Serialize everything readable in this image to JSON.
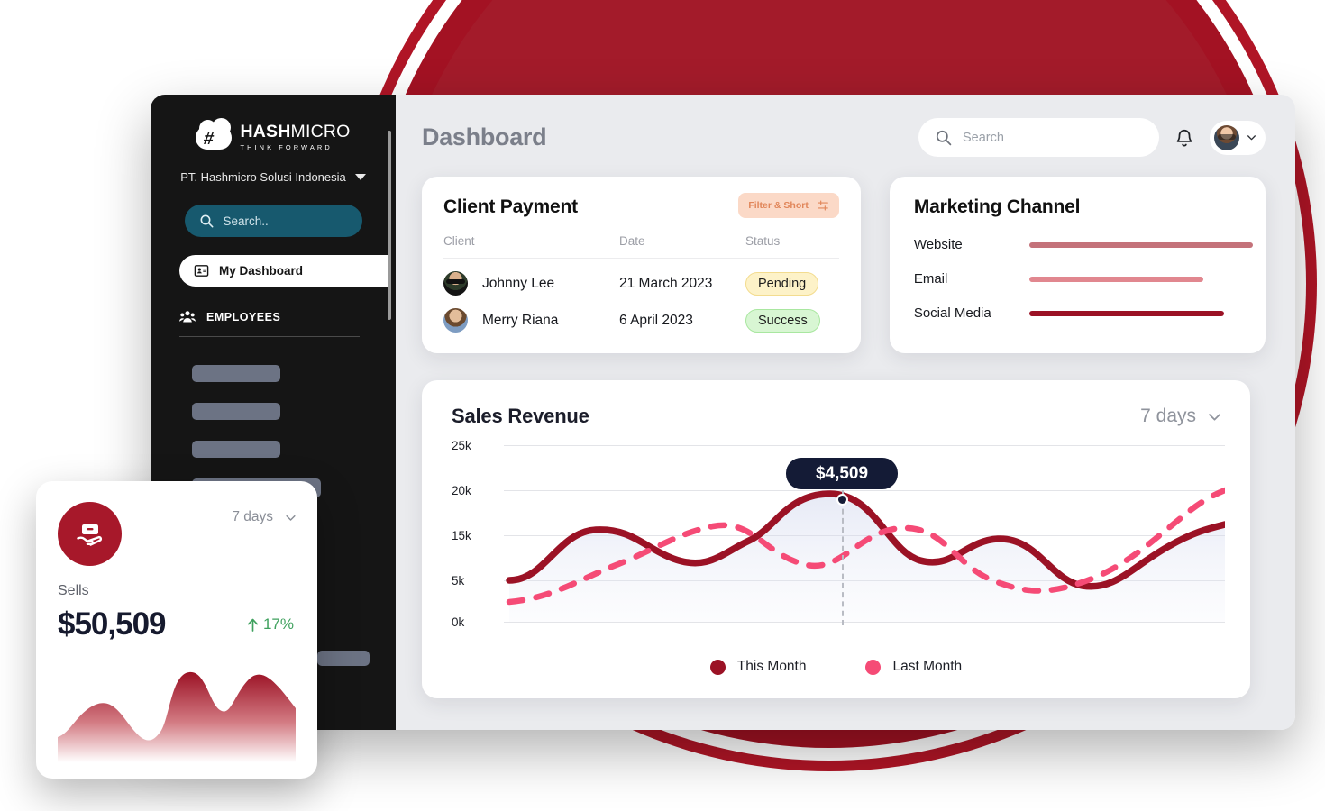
{
  "brand": {
    "logo_name_bold": "HASH",
    "logo_name_light": "MICRO",
    "logo_tagline": "THINK FORWARD",
    "logo_glyph": "#",
    "accent_red": "#a7182a",
    "accent_pink": "#f54b76",
    "sidebar_bg": "#151515",
    "search_bg": "#17596e"
  },
  "sidebar": {
    "company": "PT. Hashmicro Solusi Indonesia",
    "company_caret_icon": "chevron-down-icon",
    "search": {
      "placeholder": "Search..",
      "icon": "search-icon"
    },
    "nav_active": {
      "label": "My Dashboard",
      "icon": "dashboard-icon"
    },
    "section": {
      "label": "EMPLOYEES",
      "icon": "people-icon"
    },
    "placeholder_items": 5
  },
  "header": {
    "title": "Dashboard",
    "search": {
      "placeholder": "Search",
      "value": "",
      "icon": "search-icon"
    },
    "notification_icon": "bell-icon",
    "avatar_icon": "avatar",
    "avatar_caret_icon": "chevron-down-icon"
  },
  "client_payment": {
    "title": "Client Payment",
    "filter_button": {
      "label": "Filter & Short",
      "icon": "sliders-icon"
    },
    "columns": [
      "Client",
      "Date",
      "Status"
    ],
    "rows": [
      {
        "client": "Johnny Lee",
        "date": "21 March 2023",
        "status": "Pending",
        "status_type": "pending"
      },
      {
        "client": "Merry Riana",
        "date": "6 April 2023",
        "status": "Success",
        "status_type": "success"
      }
    ]
  },
  "marketing_channel": {
    "title": "Marketing Channel",
    "chart_data": {
      "type": "bar",
      "orientation": "horizontal",
      "title": "Marketing Channel",
      "categories": [
        "Website",
        "Email",
        "Social Media"
      ],
      "values": [
        100,
        78,
        87
      ],
      "colors": [
        "#c4727a",
        "#e1878f",
        "#9b1225"
      ],
      "xlabel": "",
      "ylabel": "",
      "xlim": [
        0,
        100
      ],
      "grid": false,
      "legend": "none"
    }
  },
  "sales_revenue": {
    "title": "Sales Revenue",
    "range": {
      "label": "7 days",
      "icon": "chevron-down-icon"
    },
    "tooltip_value": "$4,509",
    "legend": [
      {
        "label": "This Month",
        "color": "#9b1225"
      },
      {
        "label": "Last Month",
        "color": "#f54b76"
      }
    ],
    "chart_data": {
      "type": "line",
      "title": "Sales Revenue",
      "xlabel": "",
      "ylabel": "",
      "ytick_labels": [
        "25k",
        "20k",
        "15k",
        "5k",
        "0k"
      ],
      "ylim": [
        0,
        25000
      ],
      "grid": true,
      "legend": "bottom-center",
      "annotation": {
        "text": "$4,509",
        "x_index": 3,
        "series": "This Month"
      },
      "x": [
        0,
        1,
        2,
        3,
        4,
        5,
        6,
        7,
        8,
        9,
        10
      ],
      "series": [
        {
          "name": "This Month",
          "color": "#9b1225",
          "style": "solid",
          "values": [
            5000,
            12000,
            17000,
            16000,
            11000,
            21000,
            14500,
            16500,
            12500,
            11000,
            19500
          ]
        },
        {
          "name": "Last Month",
          "color": "#f54b76",
          "style": "dashed",
          "values": [
            3000,
            6500,
            11000,
            15500,
            17000,
            15500,
            10500,
            16500,
            10000,
            9500,
            21500
          ]
        }
      ]
    }
  },
  "sells_card": {
    "icon": "money-hand-icon",
    "range": {
      "label": "7 days",
      "icon": "chevron-down-icon"
    },
    "label": "Sells",
    "value": "$50,509",
    "delta": "17%",
    "delta_icon": "arrow-up-icon",
    "delta_color": "#3fa15e",
    "chart_data": {
      "type": "area",
      "title": "Sells",
      "xlabel": "",
      "ylabel": "",
      "x": [
        0,
        1,
        2,
        3,
        4,
        5,
        6,
        7,
        8
      ],
      "values": [
        18,
        52,
        60,
        30,
        22,
        76,
        58,
        66,
        40
      ],
      "color": "#a7182a",
      "grid": false,
      "legend": "none"
    }
  }
}
